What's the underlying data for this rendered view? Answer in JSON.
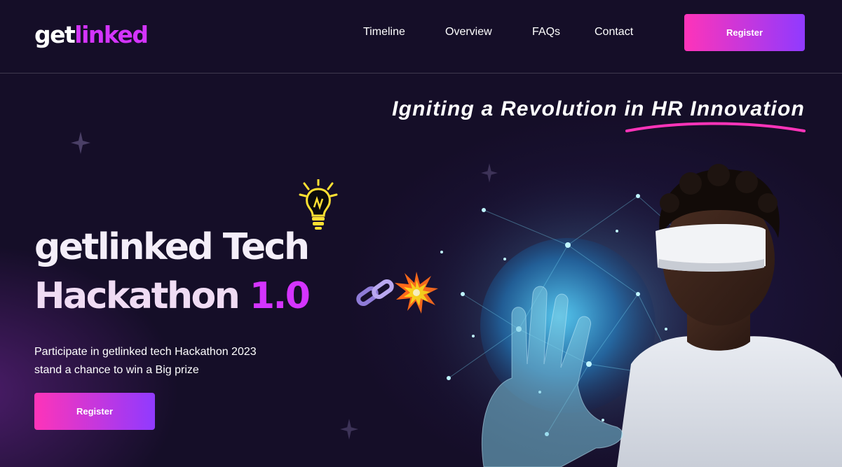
{
  "brand": {
    "part1": "get",
    "part2": "linked"
  },
  "nav": {
    "links": [
      "Timeline",
      "Overview",
      "FAQs",
      "Contact"
    ],
    "register_label": "Register"
  },
  "hero": {
    "tagline": "Igniting a Revolution in HR Innovation",
    "headline_line1": "getlinked Tech",
    "headline_line2": "Hackathon",
    "version": "1.0",
    "description_line1": "Participate in getlinked tech Hackathon 2023",
    "description_line2": "stand a chance to win a Big prize",
    "register_label": "Register"
  },
  "colors": {
    "background": "#150e28",
    "accent_purple": "#d434fe",
    "gradient_start": "#fe34b9",
    "gradient_end": "#903aff"
  },
  "icons": [
    "lightbulb-icon",
    "chain-link-icon",
    "explosion-icon",
    "star-sparkle-icon"
  ]
}
